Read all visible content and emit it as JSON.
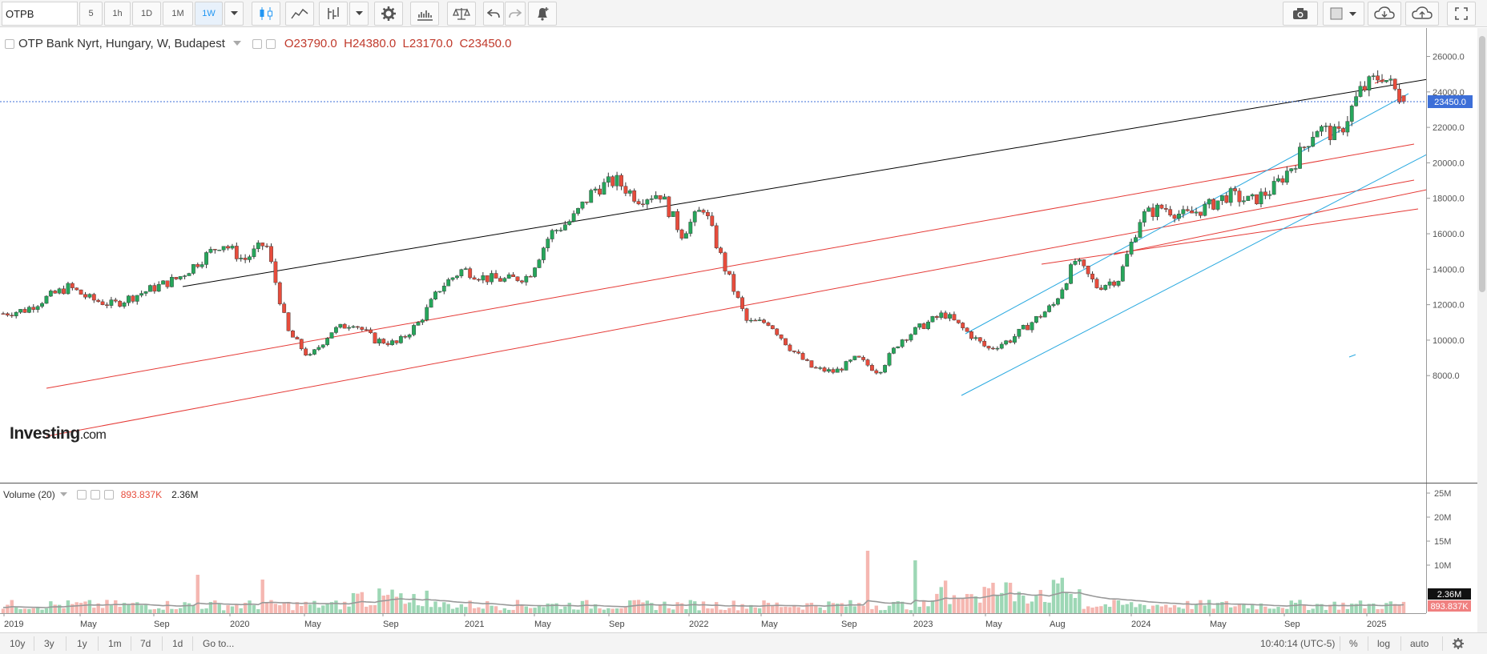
{
  "toolbar": {
    "symbol": "OTPB",
    "intervals": [
      "5",
      "1h",
      "1D",
      "1M",
      "1W"
    ],
    "active_interval": "1W"
  },
  "legend": {
    "title": "OTP Bank Nyrt, Hungary, W, Budapest",
    "open": "O23790.0",
    "high": "H24380.0",
    "low": "L23170.0",
    "close": "C23450.0"
  },
  "volume_legend": {
    "title": "Volume (20)",
    "value1": "893.837K",
    "value2": "2.36M"
  },
  "logo": {
    "brand": "Investing",
    "suffix": ".com"
  },
  "price_axis": {
    "ticks": [
      "26000.0",
      "24000.0",
      "22000.0",
      "20000.0",
      "18000.0",
      "16000.0",
      "14000.0",
      "12000.0",
      "10000.0",
      "8000.0"
    ],
    "last_price": "23450.0"
  },
  "volume_axis": {
    "ticks": [
      "25M",
      "20M",
      "15M",
      "10M"
    ],
    "last_ma": "2.36M",
    "last_vol": "893.837K"
  },
  "time_axis": {
    "labels": [
      "2019",
      "May",
      "Sep",
      "2020",
      "May",
      "Sep",
      "2021",
      "May",
      "Sep",
      "2022",
      "May",
      "Sep",
      "2023",
      "May",
      "Aug",
      "2024",
      "May",
      "Sep",
      "2025"
    ]
  },
  "bottombar": {
    "ranges": [
      "10y",
      "3y",
      "1y",
      "1m",
      "7d",
      "1d"
    ],
    "goto": "Go to...",
    "clock": "10:40:14 (UTC-5)",
    "percent": "%",
    "log": "log",
    "auto": "auto"
  },
  "colors": {
    "up": "#26a65b",
    "down": "#e74c3c",
    "resistance": "#000000",
    "channel_red": "#e53935",
    "channel_blue": "#29a9e0",
    "price_tag": "#3d6fd8"
  },
  "chart_data": {
    "type": "candlestick",
    "series": [
      {
        "name": "OTP Bank Nyrt",
        "values": [
          11500,
          11700,
          12400,
          13000,
          12300,
          12000,
          12500,
          13000,
          13500,
          14500,
          15500,
          14500,
          15500,
          10500,
          9000,
          10500,
          11000,
          10000,
          9800,
          11000,
          13000,
          14000,
          13500,
          13400,
          13600,
          16000,
          16800,
          18500,
          19000,
          18000,
          18300,
          16000,
          17500,
          14000,
          11000,
          11000,
          9500,
          8400,
          8200,
          9000,
          8200,
          10000,
          10800,
          11500,
          10500,
          9500,
          10000,
          11000,
          12000,
          14500,
          13000,
          13500,
          17000,
          17500,
          17000,
          17500,
          18200,
          17800,
          18500,
          20000,
          22000,
          21500,
          24000,
          25000,
          23450
        ]
      }
    ],
    "ylim": [
      7500,
      27000
    ]
  }
}
